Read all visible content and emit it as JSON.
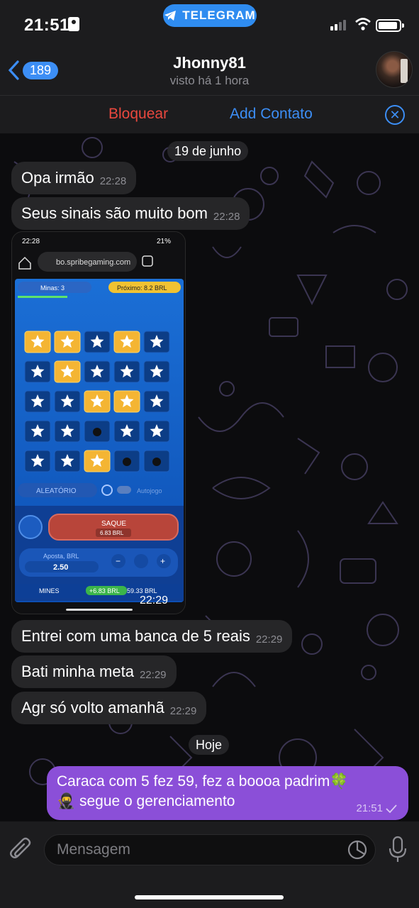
{
  "statusbar": {
    "time": "21:51",
    "app_pill": "TELEGRAM"
  },
  "header": {
    "back_count": "189",
    "name": "Jhonny81",
    "last_seen": "visto há 1 hora"
  },
  "actions": {
    "block": "Bloquear",
    "add_contact": "Add Contato"
  },
  "chat": {
    "date_1": "19 de junho",
    "date_2": "Hoje",
    "messages": [
      {
        "text": "Opa irmão",
        "time": "22:28"
      },
      {
        "text": "Seus sinais são muito bom",
        "time": "22:28"
      },
      {
        "text": "Entrei com uma banca de 5 reais",
        "time": "22:29"
      },
      {
        "text": "Bati minha meta",
        "time": "22:29"
      },
      {
        "text": "Agr só volto amanhã",
        "time": "22:29"
      }
    ],
    "photo_time": "22:29",
    "outgoing": {
      "line1": "Caraca com 5 fez 59, fez a boooa padrim🍀",
      "line2": "🥷 segue o gerenciamento",
      "time": "21:51"
    }
  },
  "screenshot": {
    "status_time": "22:28",
    "battery": "21%",
    "url": "bo.spribegaming.com",
    "mines_select": "Minas: 3",
    "next_label": "Próximo: 8.2 BRL",
    "grid": [
      [
        "star-gold",
        "star-gold",
        "star",
        "star-gold",
        "star"
      ],
      [
        "star",
        "star-gold",
        "star",
        "star",
        "star"
      ],
      [
        "star",
        "star",
        "star-gold",
        "star-gold",
        "star"
      ],
      [
        "star",
        "star",
        "bomb",
        "star",
        "star"
      ],
      [
        "star",
        "star",
        "star-gold",
        "bomb",
        "bomb"
      ]
    ],
    "random_btn": "ALEATÓRIO",
    "autoplay": "Autojogo",
    "cashout": "SAQUE",
    "cashout_amount": "6.83 BRL",
    "bet_label": "Aposta, BRL",
    "bet_value": "2.50",
    "footer_game": "MINES",
    "footer_win": "+6.83 BRL",
    "footer_balance": "59.33 BRL"
  },
  "composer": {
    "placeholder": "Mensagem"
  },
  "colors": {
    "accent": "#3c8ef5",
    "danger": "#e9483e",
    "outgoing": "#8b4fd8"
  }
}
